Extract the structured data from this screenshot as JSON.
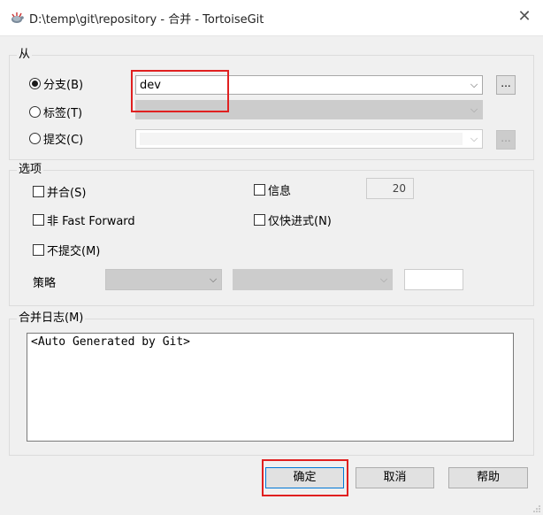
{
  "window": {
    "title": "D:\\temp\\git\\repository - 合并 - TortoiseGit",
    "close_glyph": "✕"
  },
  "from_group": {
    "label": "从",
    "branch": {
      "label": "分支(B)",
      "value": "dev",
      "checked": true
    },
    "tag": {
      "label": "标签(T)",
      "value": "",
      "checked": false
    },
    "commit": {
      "label": "提交(C)",
      "value": "",
      "checked": false
    },
    "browse_label": "..."
  },
  "options_group": {
    "label": "选项",
    "squash": {
      "label": "并合(S)",
      "checked": false
    },
    "no_ff": {
      "label": "非 Fast Forward",
      "checked": false
    },
    "no_commit": {
      "label": "不提交(M)",
      "checked": false
    },
    "log": {
      "label": "信息",
      "checked": false,
      "count": "20"
    },
    "ff_only": {
      "label": "仅快进式(N)",
      "checked": false
    },
    "strategy": {
      "label": "策略",
      "value": "",
      "option_value": "",
      "extra_value": ""
    }
  },
  "merge_log_group": {
    "label": "合并日志(M)",
    "text": "<Auto Generated by Git>"
  },
  "buttons": {
    "ok": "确定",
    "cancel": "取消",
    "help": "帮助"
  },
  "colors": {
    "highlight": "#e02020",
    "dialog_bg": "#f0f0f0",
    "disabled_bg": "#cccccc"
  }
}
